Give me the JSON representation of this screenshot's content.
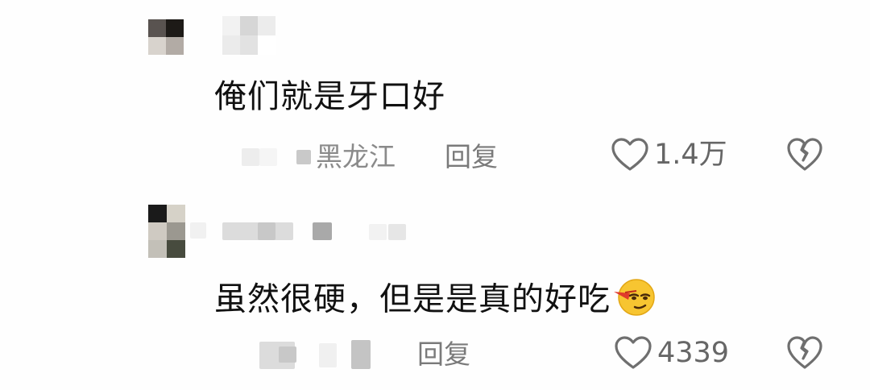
{
  "comments": [
    {
      "text": "俺们就是牙口好",
      "location": "黑龙江",
      "reply_label": "回复",
      "likes": "1.4万"
    },
    {
      "text": "虽然很硬，但是是真的好吃",
      "reply_label": "回复",
      "likes": "4339",
      "emoji": "smirking-face-emoji"
    }
  ],
  "icons": {
    "like": "heart-outline-icon",
    "dislike": "broken-heart-icon"
  },
  "colors": {
    "text": "#111111",
    "meta": "#8a8a8a",
    "icon": "#6f6f6f"
  }
}
